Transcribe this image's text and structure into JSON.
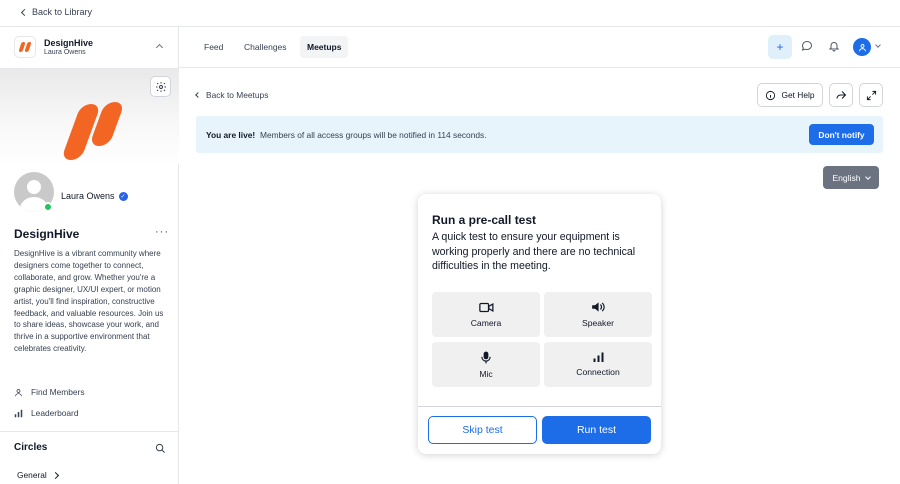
{
  "topbar": {
    "back_label": "Back to Library"
  },
  "sidebar": {
    "brand_name": "DesignHive",
    "brand_user": "Laura Owens",
    "profile_name": "Laura Owens",
    "community_title": "DesignHive",
    "description": "DesignHive is a vibrant community where designers come together to connect, collaborate, and grow. Whether you're a graphic designer, UX/UI expert, or motion artist, you'll find inspiration, constructive feedback, and valuable resources. Join us to share ideas, showcase your work, and thrive in a supportive environment that celebrates creativity.",
    "nav": [
      {
        "label": "Find Members",
        "icon": "person-icon"
      },
      {
        "label": "Leaderboard",
        "icon": "bar-chart-icon"
      }
    ],
    "circles_title": "Circles",
    "circles": [
      {
        "label": "General"
      }
    ],
    "brand_color": "#f26522"
  },
  "header": {
    "tabs": [
      {
        "label": "Feed",
        "active": false
      },
      {
        "label": "Challenges",
        "active": false
      },
      {
        "label": "Meetups",
        "active": true
      }
    ],
    "icons": [
      "plus-icon",
      "chat-icon",
      "bell-icon",
      "user-avatar-icon"
    ]
  },
  "main": {
    "back_label": "Back to Meetups",
    "get_help_label": "Get Help",
    "banner": {
      "strong": "You are live!",
      "text": "Members of all access groups will be notified in 114 seconds.",
      "button": "Don't notify"
    },
    "language": "English",
    "accent_color": "#1d6ce8"
  },
  "precall": {
    "title": "Run a pre-call test",
    "description": "A quick test to ensure your equipment is working properly and there are no technical difficulties in the meeting.",
    "tiles": [
      {
        "label": "Camera",
        "icon": "camera-icon"
      },
      {
        "label": "Speaker",
        "icon": "speaker-icon"
      },
      {
        "label": "Mic",
        "icon": "mic-icon"
      },
      {
        "label": "Connection",
        "icon": "signal-icon"
      }
    ],
    "skip_label": "Skip test",
    "run_label": "Run test"
  }
}
